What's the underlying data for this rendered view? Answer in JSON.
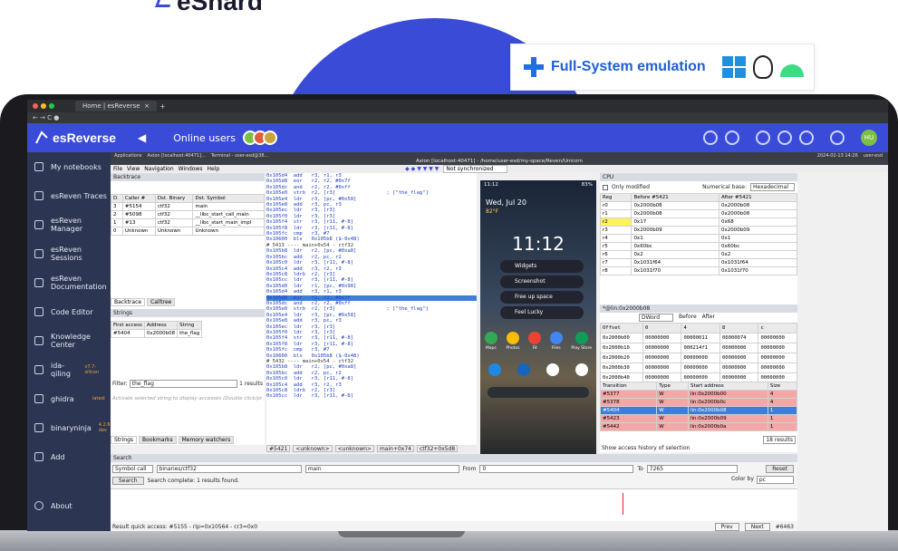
{
  "brand": {
    "name": "eShard"
  },
  "badge": {
    "label": "Full-System emulation"
  },
  "browser": {
    "tab_title": "Home | esReverse",
    "close": "×",
    "new_tab": "+"
  },
  "appbar": {
    "title": "esReverse",
    "online_label": "Online users",
    "user_initials": "HU"
  },
  "sidebar": {
    "items": [
      {
        "label": "My notebooks",
        "sub": ""
      },
      {
        "label": "esReven Traces",
        "sub": ""
      },
      {
        "label": "esReven Manager",
        "sub": ""
      },
      {
        "label": "esReven Sessions",
        "sub": ""
      },
      {
        "label": "esReven Documentation",
        "sub": ""
      },
      {
        "label": "Code Editor",
        "sub": ""
      },
      {
        "label": "Knowledge Center",
        "sub": ""
      },
      {
        "label": "ida-qiling",
        "sub": "v7.7-silicon"
      },
      {
        "label": "ghidra",
        "sub": "latest"
      },
      {
        "label": "binaryninja",
        "sub": "4.2.6204-dev"
      },
      {
        "label": "Add",
        "sub": ""
      }
    ],
    "about": "About"
  },
  "desktop": {
    "taskbar": [
      "Applications",
      "Axion [localhost:40471]...",
      "Terminal - user-esd@38..."
    ],
    "clock": "2024-02-13 14:26",
    "user": "user-esd",
    "window_title": "Axion [localhost:40471] - /home/user-esd/my-space/Reven/Unicorn",
    "menu": [
      "File",
      "View",
      "Navigation",
      "Windows",
      "Help"
    ],
    "sync": "Not synchronized"
  },
  "backtrace": {
    "title": "Backtrace",
    "columns": [
      "D.",
      "Caller #",
      "Dst. Binary",
      "Dst. Symbol"
    ],
    "rows": [
      [
        "3",
        "#5154",
        "ctf32",
        "main"
      ],
      [
        "2",
        "#5098",
        "ctf32",
        "__libc_start_call_main"
      ],
      [
        "1",
        "#13",
        "ctf32",
        "__libc_start_main_impl"
      ],
      [
        "0",
        "Unknown",
        "Unknown",
        "Unknown"
      ]
    ],
    "tabs": [
      "Backtrace",
      "Calltree"
    ]
  },
  "strings": {
    "title": "Strings",
    "columns": [
      "First access",
      "Address",
      "String"
    ],
    "rows": [
      [
        "#5404",
        "0x2000b08",
        "the_flag"
      ]
    ],
    "filter_label": "Filter:",
    "filter_value": "the_flag",
    "results": "1 results",
    "hint": "Activate selected string to display accesses (Double click/pr",
    "tabs": [
      "Strings",
      "Bookmarks",
      "Memory watchers"
    ]
  },
  "code": {
    "lines": [
      "0x105d4  add   r3, r1, r3",
      "0x105d8  eor   r2, r2, #0x7f",
      "0x105dc  and   r2, r2, #0xff",
      "0x105e0  strb  r2, [r3]                 ; [\"the_flag\"]",
      "0x105e4  ldr   r3, [pc, #0x58]",
      "0x105e8  add   r3, pc, r3",
      "0x105ec  ldr   r3, [r3]",
      "0x105f0  ldr   r3, [r3]",
      "0x105f4  str   r3, [r11, #-8]",
      "0x105f8  ldr   r3, [r11, #-8]",
      "0x105fc  cmp   r3, #7",
      "0x10600  bls   0x105b8 ($-0x48)",
      "",
      "# 5413 ---- main+0x54 - ctf32",
      "0x105b8  ldr   r2, [pc, #0xa8]",
      "0x105bc  add   r2, pc, r2",
      "0x105c0  ldr   r3, [r11, #-8]",
      "0x105c4  add   r3, r2, r3",
      "0x105c8  ldrb  r2, [r3]",
      "0x105cc  ldr   r3, [r11, #-8]",
      "0x105d0  ldr   r1, [pc, #0x98]",
      "0x105d4  add   r3, r1, r3",
      "0x105d8  eor   r2, r2, #0x7f",
      "0x105dc  and   r2, r2, #0xff",
      "0x105e0  strb  r2, [r3]                 ; [\"the_flag\"]",
      "0x105e4  ldr   r3, [pc, #0x58]",
      "0x105e8  add   r3, pc, r3",
      "0x105ec  ldr   r3, [r3]",
      "0x105f0  ldr   r3, [r3]",
      "0x105f4  str   r3, [r11, #-8]",
      "0x105f8  ldr   r3, [r11, #-8]",
      "0x105fc  cmp   r3, #7",
      "0x10600  bls   0x105b8 ($-0x48)",
      "",
      "# 5432 ---- main+0x54 - ctf32",
      "0x105b8  ldr   r2, [pc, #0xa8]",
      "0x105bc  add   r2, pc, r2",
      "0x105c0  ldr   r3, [r11, #-8]",
      "0x105c4  add   r3, r2, r3",
      "0x105c8  ldrb  r2, [r3]",
      "0x105cc  ldr   r3, [r11, #-8]"
    ],
    "status": [
      "#5421",
      "<unknown>",
      "<unknown>",
      "main+0x74",
      "ctf32+0x5d8"
    ]
  },
  "phone": {
    "status_time": "11:12",
    "battery": "83%",
    "date": "Wed, Jul 20",
    "weather": "82°F",
    "clock": "11:12",
    "menu": [
      "Widgets",
      "Screenshot",
      "Free up space",
      "Feel Lucky"
    ],
    "apps": [
      "Maps",
      "Photos",
      "Fit",
      "Files",
      "Play Store"
    ]
  },
  "cpu": {
    "title": "CPU",
    "only_modified": "Only modified",
    "base_label": "Numerical base:",
    "base_value": "Hexadecimal",
    "columns": [
      "Reg",
      "Before #5421",
      "After #5421"
    ],
    "rows": [
      [
        "r0",
        "0x2000b08",
        "0x2000b08"
      ],
      [
        "r1",
        "0x2000b08",
        "0x2000b08"
      ],
      [
        "r2",
        "0x17",
        "0x68"
      ],
      [
        "r3",
        "0x2000b09",
        "0x2000b09"
      ],
      [
        "r4",
        "0x1",
        "0x1"
      ],
      [
        "r5",
        "0x60bc",
        "0x60bc"
      ],
      [
        "r6",
        "0x2",
        "0x2"
      ],
      [
        "r7",
        "0x1031f64",
        "0x1031f64"
      ],
      [
        "r8",
        "0x1031f70",
        "0x1031f70"
      ]
    ]
  },
  "memory": {
    "title": "*@lin:0x2000b08",
    "width": "DWord",
    "before": "Before",
    "after": "After",
    "columns": [
      "Offset",
      "0",
      "4",
      "8",
      "c"
    ],
    "rows": [
      [
        "0x2000b00",
        "00000000",
        "00000011",
        "00000074",
        "00000000"
      ],
      [
        "0x2000b10",
        "00000000",
        "000214f1",
        "00000000",
        "00000000"
      ],
      [
        "0x2000b20",
        "00000000",
        "00000000",
        "00000000",
        "00000000"
      ],
      [
        "0x2000b30",
        "00000000",
        "00000000",
        "00000000",
        "00000000"
      ],
      [
        "0x2000b40",
        "00000000",
        "00000000",
        "00000000",
        "00000000"
      ]
    ]
  },
  "transitions": {
    "columns": [
      "Transition",
      "Type",
      "Start address",
      "Size"
    ],
    "rows": [
      [
        "#5377",
        "W",
        "lin:0x2000b00",
        "4"
      ],
      [
        "#5378",
        "W",
        "lin:0x2000b0c",
        "4"
      ],
      [
        "#5404",
        "W",
        "lin:0x2000b08",
        "1"
      ],
      [
        "#5423",
        "W",
        "lin:0x2000b09",
        "1"
      ],
      [
        "#5442",
        "W",
        "lin:0x2000b0a",
        "1"
      ]
    ],
    "results": "18 results",
    "show_history": "Show access history of selection"
  },
  "search": {
    "title": "Search",
    "kind": "Symbol call",
    "binary": "binaries/ctf32",
    "symbol": "main",
    "from_label": "From",
    "from_value": "0",
    "to_label": "To",
    "to_value": "7265",
    "reset": "Reset",
    "search_button": "Search",
    "status": "Search complete: 1 results found.",
    "color_label": "Color by",
    "color_value": "pc"
  },
  "quick": {
    "label": "Result quick access: #5155 - rip=0x10564 - cr3=0x0",
    "prev": "Prev",
    "next": "Next",
    "count": "#6463"
  }
}
